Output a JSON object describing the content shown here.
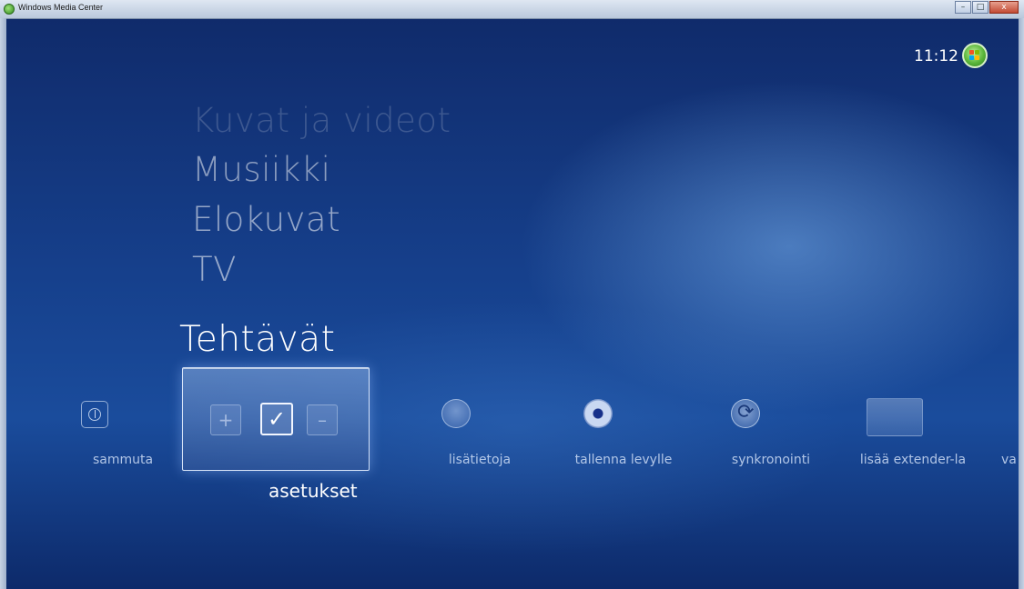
{
  "window": {
    "title": "Windows Media Center",
    "buttons": [
      "–",
      "□",
      "x"
    ]
  },
  "header": {
    "clock": "11:12"
  },
  "menu": {
    "items": [
      "Kuvat ja videot",
      "Musiikki",
      "Elokuvat",
      "TV"
    ],
    "current": "Tehtävät"
  },
  "strip": {
    "items": [
      "sammuta",
      "asetukset",
      "lisätietoja",
      "tallenna levylle",
      "synkronointi",
      "lisää extender-la",
      "va"
    ],
    "focused_index": 1,
    "focused_glyphs": {
      "left": "+",
      "center": "✓",
      "right": "–"
    }
  },
  "colors": {
    "background": "#16408c",
    "text": "#ffffff",
    "muted_text": "#cddcf5",
    "orb_green": "#5ab63a"
  },
  "icons": {
    "sammuta": "power-icon",
    "asetukset": "checkmark-icon",
    "lisätietoja": "windows-logo-icon",
    "tallenna levylle": "disc-icon",
    "synkronointi": "sync-icon",
    "lisää extender-la": "monitor-icon"
  }
}
